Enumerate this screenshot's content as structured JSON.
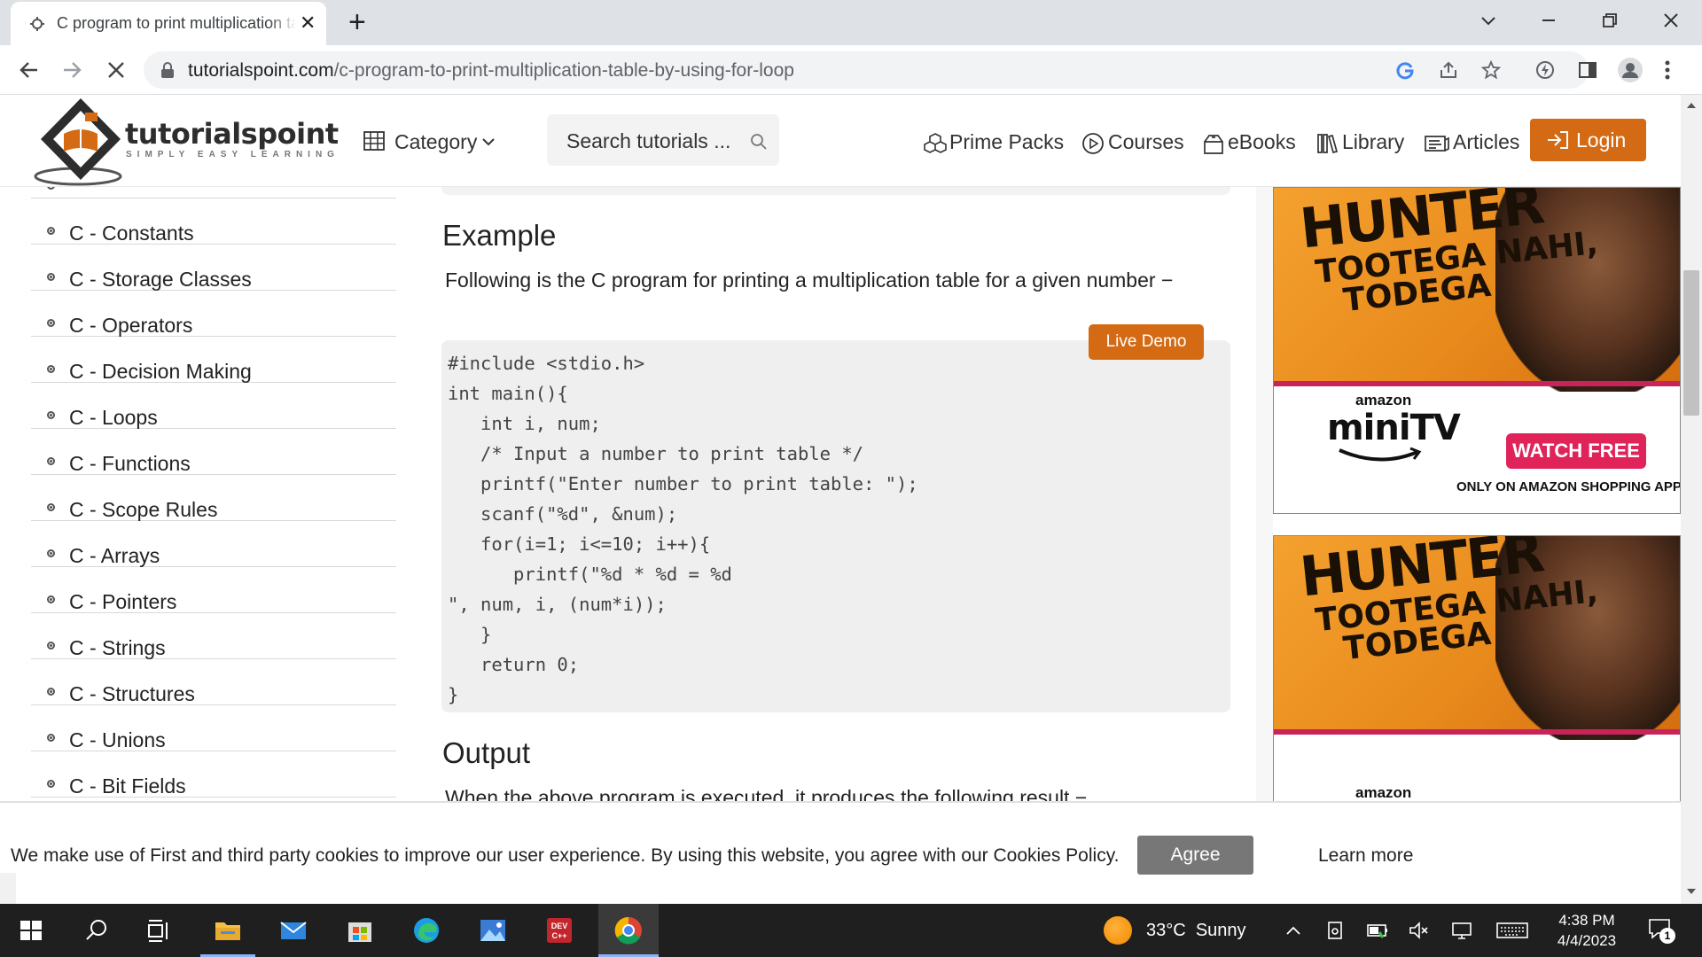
{
  "browser": {
    "tab_title": "C program to print multiplication table by using for loop",
    "tab_close": "✕",
    "new_tab": "+",
    "url_domain": "tutorialspoint.com",
    "url_path": "/c-program-to-print-multiplication-table-by-using-for-loop"
  },
  "site": {
    "logo_text": "tutorialspoint",
    "logo_tagline": "SIMPLY EASY LEARNING",
    "category_label": "Category",
    "search_placeholder": "Search tutorials ...",
    "nav": [
      {
        "label": "Prime Packs",
        "icon": "cubes-icon"
      },
      {
        "label": "Courses",
        "icon": "play-circle-icon"
      },
      {
        "label": "eBooks",
        "icon": "book-box-icon"
      },
      {
        "label": "Library",
        "icon": "library-icon"
      },
      {
        "label": "Articles",
        "icon": "article-icon"
      }
    ],
    "login_label": "Login",
    "brand_color": "#d46a13"
  },
  "sidebar": {
    "items": [
      {
        "label": "C - Constants"
      },
      {
        "label": "C - Storage Classes"
      },
      {
        "label": "C - Operators"
      },
      {
        "label": "C - Decision Making"
      },
      {
        "label": "C - Loops"
      },
      {
        "label": "C - Functions"
      },
      {
        "label": "C - Scope Rules"
      },
      {
        "label": "C - Arrays"
      },
      {
        "label": "C - Pointers"
      },
      {
        "label": "C - Strings"
      },
      {
        "label": "C - Structures"
      },
      {
        "label": "C - Unions"
      },
      {
        "label": "C - Bit Fields"
      }
    ]
  },
  "main": {
    "example_heading": "Example",
    "example_text": "Following is the C program for printing a multiplication table for a given number −",
    "live_demo_label": "Live Demo",
    "code": "#include <stdio.h>\nint main(){\n   int i, num;\n   /* Input a number to print table */\n   printf(\"Enter number to print table: \");\n   scanf(\"%d\", &num);\n   for(i=1; i<=10; i++){\n      printf(\"%d * %d = %d\n\", num, i, (num*i));\n   }\n   return 0;\n}",
    "output_heading": "Output",
    "output_text": "When the above program is executed, it produces the following result −"
  },
  "ads": [
    {
      "title_big": "HUNTER",
      "title_line1": "TOOTEGA NAHI,",
      "title_line2": "TODEGA",
      "brand_small": "amazon",
      "brand": "miniTV",
      "cta": "WATCH FREE",
      "note": "ONLY ON AMAZON SHOPPING APP"
    },
    {
      "title_big": "HUNTER",
      "title_line1": "TOOTEGA NAHI,",
      "title_line2": "TODEGA",
      "brand_small": "amazon"
    }
  ],
  "cookie": {
    "text": "We make use of First and third party cookies to improve our user experience. By using this website, you agree with our Cookies Policy.",
    "agree_label": "Agree",
    "learn_more_label": "Learn more"
  },
  "taskbar": {
    "weather_temp": "33°C",
    "weather_desc": "Sunny",
    "time": "4:38 PM",
    "date": "4/4/2023",
    "notification_count": "1"
  }
}
